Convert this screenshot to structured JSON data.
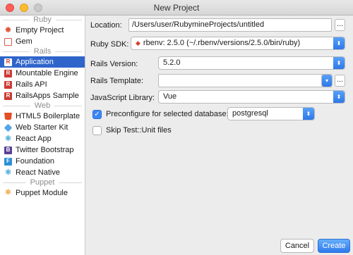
{
  "window": {
    "title": "New Project"
  },
  "sidebar": {
    "groups": [
      {
        "header": "Ruby",
        "items": [
          {
            "label": "Empty Project",
            "icon": "ruby-icon"
          },
          {
            "label": "Gem",
            "icon": "gem-icon"
          }
        ]
      },
      {
        "header": "Rails",
        "items": [
          {
            "label": "Application",
            "icon": "rails-icon",
            "selected": true
          },
          {
            "label": "Mountable Engine",
            "icon": "rails-icon"
          },
          {
            "label": "Rails API",
            "icon": "rails-icon"
          },
          {
            "label": "RailsApps Sample",
            "icon": "rails-icon"
          }
        ]
      },
      {
        "header": "Web",
        "items": [
          {
            "label": "HTML5 Boilerplate",
            "icon": "html5-icon"
          },
          {
            "label": "Web Starter Kit",
            "icon": "web-starter-kit-icon"
          },
          {
            "label": "React App",
            "icon": "react-icon"
          },
          {
            "label": "Twitter Bootstrap",
            "icon": "bootstrap-icon"
          },
          {
            "label": "Foundation",
            "icon": "foundation-icon"
          },
          {
            "label": "React Native",
            "icon": "react-icon"
          }
        ]
      },
      {
        "header": "Puppet",
        "items": [
          {
            "label": "Puppet Module",
            "icon": "puppet-icon"
          }
        ]
      }
    ]
  },
  "form": {
    "location_label": "Location:",
    "location_value": "/Users/user/RubymineProjects/untitled",
    "sdk_label": "Ruby SDK:",
    "sdk_value": "rbenv: 2.5.0 (~/.rbenv/versions/2.5.0/bin/ruby)",
    "rails_version_label": "Rails Version:",
    "rails_version_value": "5.2.0",
    "rails_template_label": "Rails Template:",
    "rails_template_value": "",
    "js_library_label": "JavaScript Library:",
    "js_library_value": "Vue",
    "preconfigure_label": "Preconfigure for selected database:",
    "preconfigure_checked": true,
    "database_value": "postgresql",
    "skip_test_label": "Skip Test::Unit files",
    "skip_test_checked": false,
    "ellipsis": "..."
  },
  "buttons": {
    "cancel": "Cancel",
    "create": "Create"
  },
  "colors": {
    "selection": "#2f65ca",
    "accent": "#3b86f7"
  }
}
